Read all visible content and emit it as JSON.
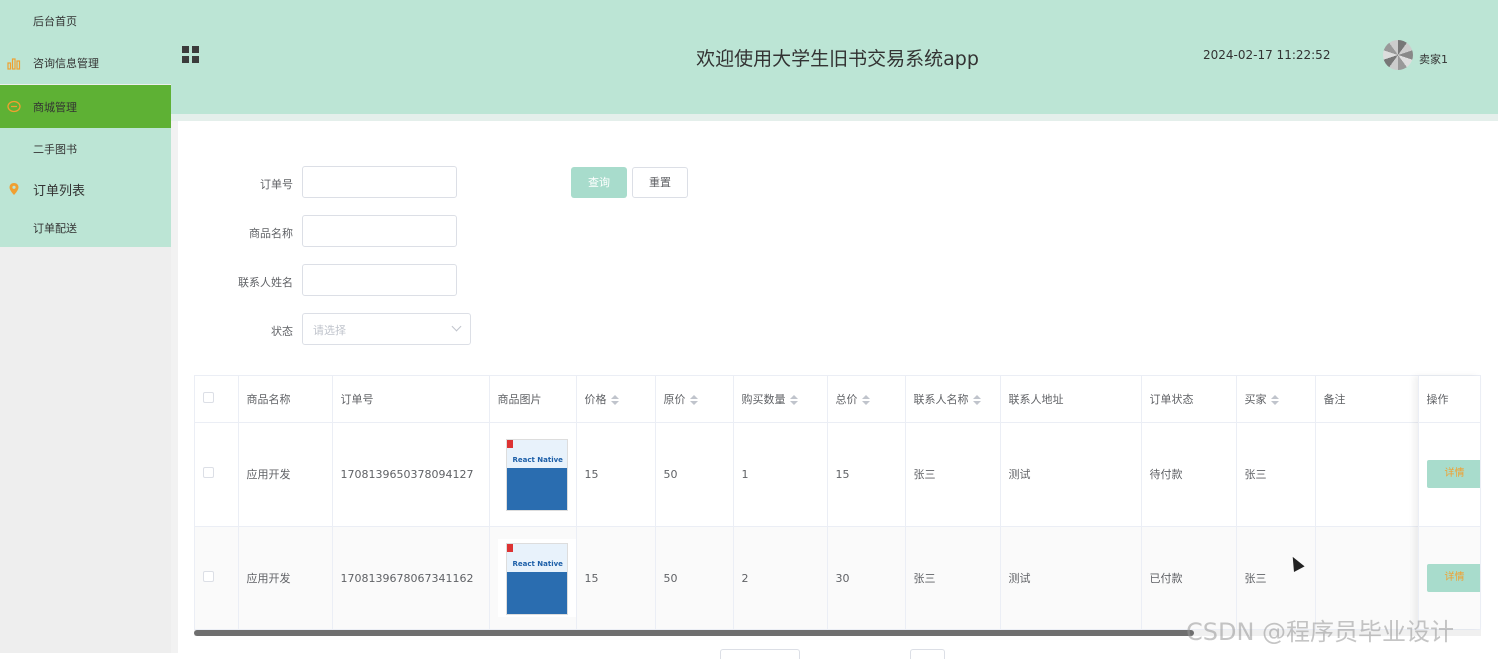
{
  "sidebar": {
    "items": [
      {
        "label": "后台首页",
        "icon": "none"
      },
      {
        "label": "咨询信息管理",
        "icon": "bar-chart-icon"
      },
      {
        "label": "商城管理",
        "icon": "chat-bubble-icon"
      },
      {
        "label": "二手图书",
        "icon": "none"
      },
      {
        "label": "订单列表",
        "icon": "location-pin-icon"
      },
      {
        "label": "订单配送",
        "icon": "none"
      }
    ],
    "colors": {
      "item_bg": "#bce5d5",
      "active_bg": "#5eb134",
      "icon_orange": "#f0a030"
    }
  },
  "header": {
    "title": "欢迎使用大学生旧书交易系统app",
    "datetime": "2024-02-17 11:22:52",
    "username": "卖家1",
    "bg_color": "#bce5d5"
  },
  "search": {
    "order_no_label": "订单号",
    "product_name_label": "商品名称",
    "contact_name_label": "联系人姓名",
    "status_label": "状态",
    "status_placeholder": "请选择",
    "query_button": "查询",
    "reset_button": "重置"
  },
  "table": {
    "columns": [
      "商品名称",
      "订单号",
      "商品图片",
      "价格",
      "原价",
      "购买数量",
      "总价",
      "联系人名称",
      "联系人地址",
      "订单状态",
      "买家",
      "备注",
      "操作"
    ],
    "rows": [
      {
        "product_name": "应用开发",
        "order_no": "1708139650378094127",
        "image_text": "React Native",
        "price": "15",
        "original_price": "50",
        "quantity": "1",
        "total": "15",
        "contact_name": "张三",
        "contact_address": "测试",
        "status": "待付款",
        "buyer": "张三",
        "remark": "",
        "action": "详情"
      },
      {
        "product_name": "应用开发",
        "order_no": "1708139678067341162",
        "image_text": "React Native",
        "price": "15",
        "original_price": "50",
        "quantity": "2",
        "total": "30",
        "contact_name": "张三",
        "contact_address": "测试",
        "status": "已付款",
        "buyer": "张三",
        "remark": "",
        "action": "详情"
      }
    ]
  },
  "watermark": "CSDN @程序员毕业设计"
}
